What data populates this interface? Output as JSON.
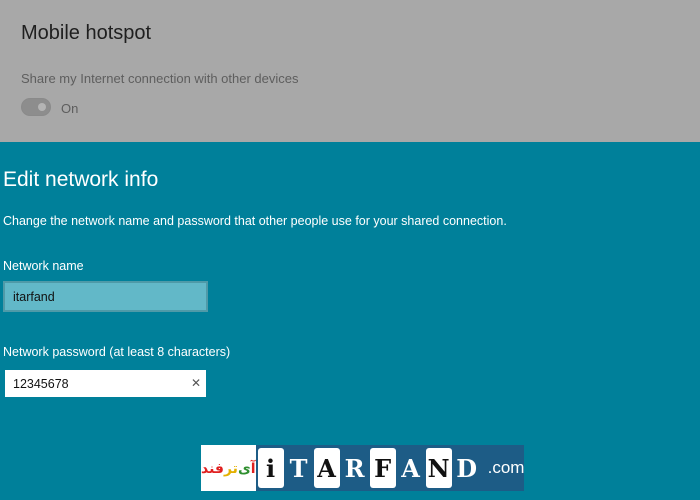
{
  "background": {
    "title": "Mobile hotspot",
    "description": "Share my Internet connection with other devices",
    "toggle_state": "On"
  },
  "dialog": {
    "title": "Edit network info",
    "description": "Change the network name and password that other people use for your shared connection.",
    "network_name": {
      "label": "Network name",
      "value": "itarfand"
    },
    "network_password": {
      "label": "Network password (at least 8 characters)",
      "value": "12345678",
      "clear_icon": "close-icon"
    }
  },
  "watermark": {
    "logo_text": "آی‌ترفند",
    "logo_text_parts": [
      "آ",
      "ی",
      "تر",
      "فند"
    ],
    "glyph_letters": [
      "i",
      "T",
      "A",
      "R",
      "F",
      "A",
      "N",
      "D"
    ],
    "suffix": ".com"
  },
  "colors": {
    "dialog_background": "#00809a",
    "dimmed_background": "#a8a8a8",
    "selected_field": "#62b8c8"
  }
}
